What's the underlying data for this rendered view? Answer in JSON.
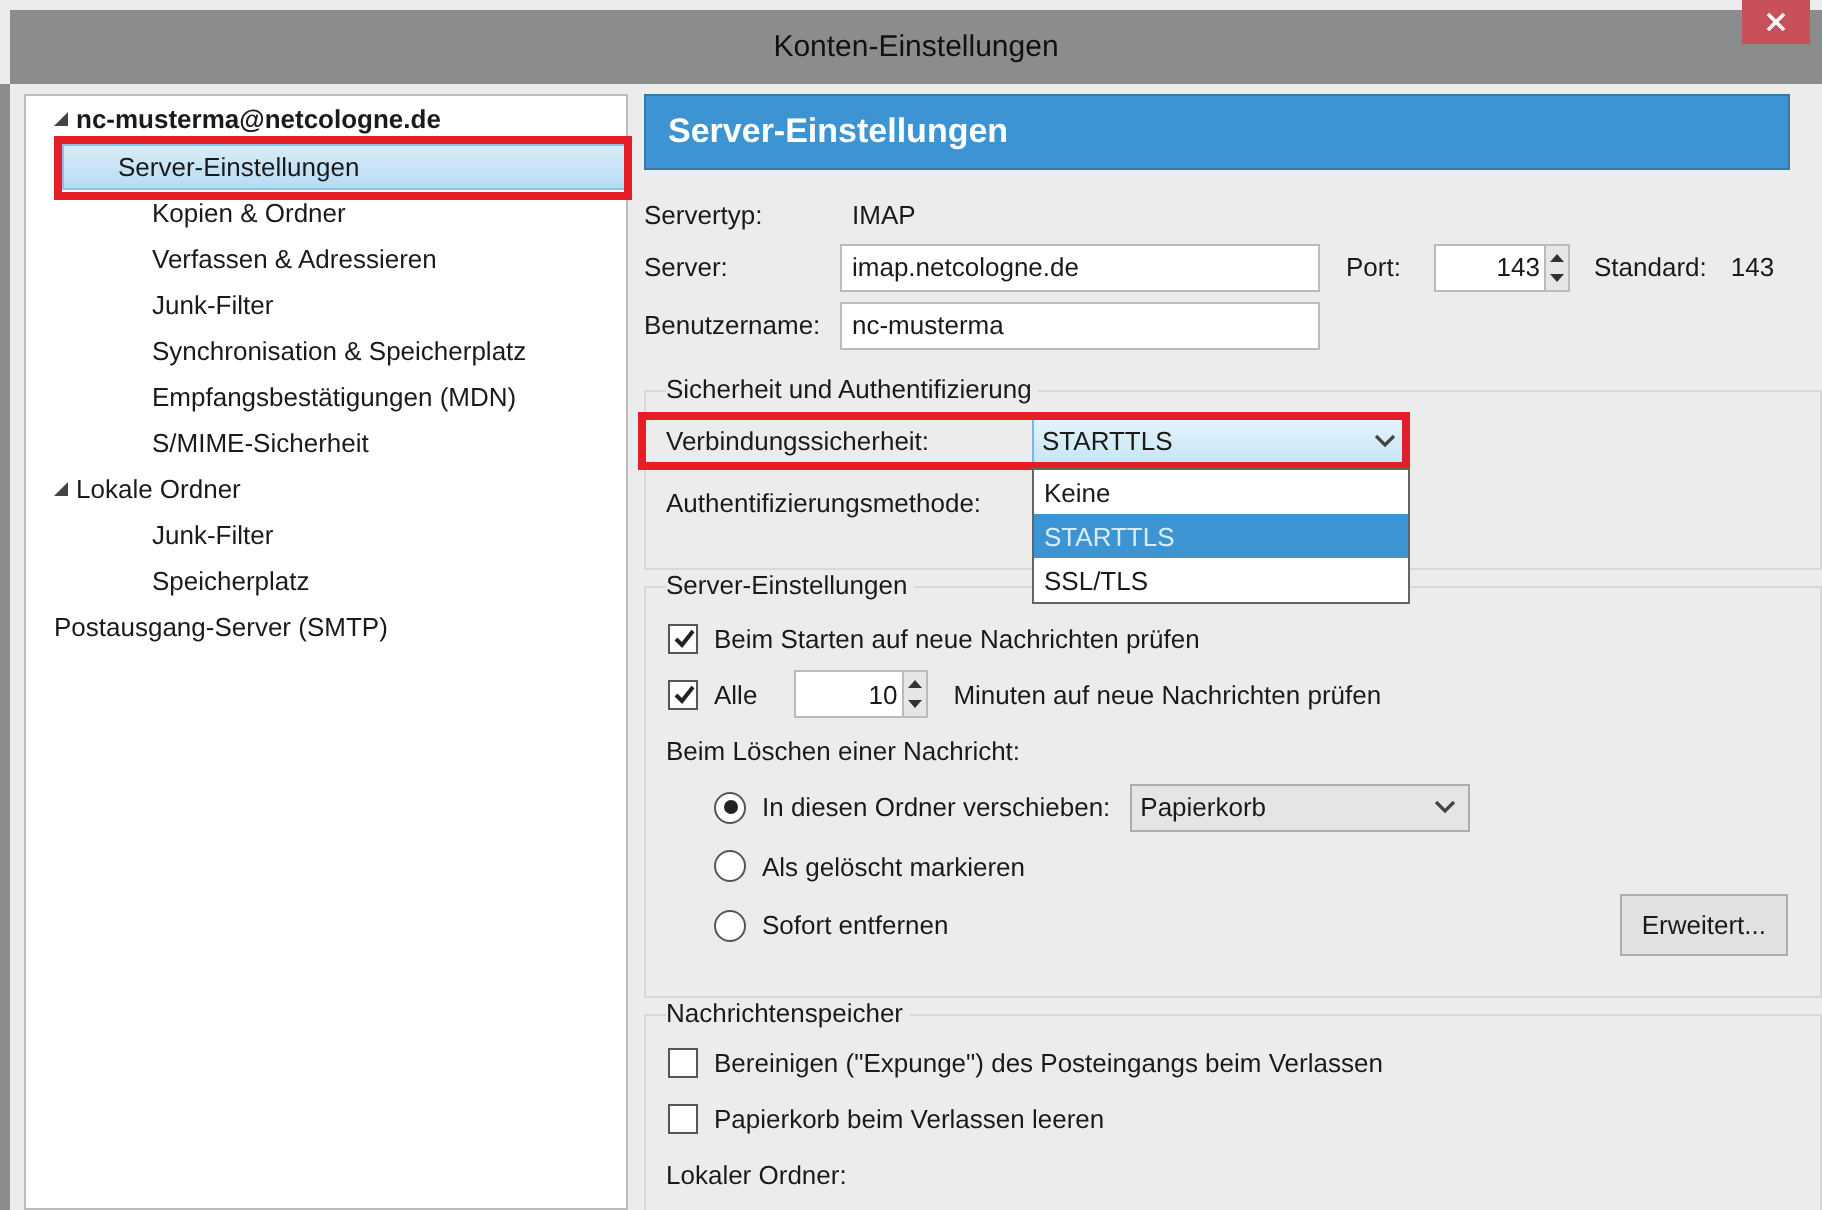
{
  "window": {
    "title": "Konten-Einstellungen"
  },
  "sidebar": {
    "items": [
      {
        "label": "nc-musterma@netcologne.de",
        "expanded": true,
        "selected": false,
        "children": [
          {
            "label": "Server-Einstellungen",
            "selected": true
          },
          {
            "label": "Kopien & Ordner",
            "selected": false
          },
          {
            "label": "Verfassen & Adressieren",
            "selected": false
          },
          {
            "label": "Junk-Filter",
            "selected": false
          },
          {
            "label": "Synchronisation & Speicherplatz",
            "selected": false
          },
          {
            "label": "Empfangsbestätigungen (MDN)",
            "selected": false
          },
          {
            "label": "S/MIME-Sicherheit",
            "selected": false
          }
        ]
      },
      {
        "label": "Lokale Ordner",
        "expanded": true,
        "selected": false,
        "children": [
          {
            "label": "Junk-Filter",
            "selected": false
          },
          {
            "label": "Speicherplatz",
            "selected": false
          }
        ]
      },
      {
        "label": "Postausgang-Server (SMTP)",
        "selected": false
      }
    ]
  },
  "panel_title": "Server-Einstellungen",
  "server_info": {
    "type_label": "Servertyp:",
    "type_value": "IMAP",
    "server_label": "Server:",
    "server_value": "imap.netcologne.de",
    "port_label": "Port:",
    "port_value": "143",
    "default_label": "Standard:",
    "default_value": "143",
    "user_label": "Benutzername:",
    "user_value": "nc-musterma"
  },
  "security": {
    "legend": "Sicherheit und Authentifizierung",
    "connection_label": "Verbindungssicherheit:",
    "connection_value": "STARTTLS",
    "auth_label": "Authentifizierungsmethode:",
    "dropdown_options": [
      {
        "label": "Keine",
        "selected": false
      },
      {
        "label": "STARTTLS",
        "selected": true
      },
      {
        "label": "SSL/TLS",
        "selected": false
      }
    ]
  },
  "server_settings": {
    "legend": "Server-Einstellungen",
    "check_on_start": {
      "label": "Beim Starten auf neue Nachrichten prüfen",
      "checked": true
    },
    "check_every": {
      "label": "Alle",
      "checked": true,
      "value": "10",
      "suffix": "Minuten auf neue Nachrichten prüfen"
    },
    "delete_label": "Beim Löschen einer Nachricht:",
    "delete_options": [
      {
        "label": "In diesen Ordner verschieben:",
        "selected": true
      },
      {
        "label": "Als gelöscht markieren",
        "selected": false
      },
      {
        "label": "Sofort entfernen",
        "selected": false
      }
    ],
    "folder_value": "Papierkorb",
    "advanced_button": "Erweitert..."
  },
  "storage": {
    "legend": "Nachrichtenspeicher",
    "options": [
      {
        "label": "Bereinigen (\"Expunge\") des Posteingangs beim Verlassen",
        "checked": false
      },
      {
        "label": "Papierkorb beim Verlassen leeren",
        "checked": false
      }
    ],
    "local_folder_label": "Lokaler Ordner:"
  }
}
